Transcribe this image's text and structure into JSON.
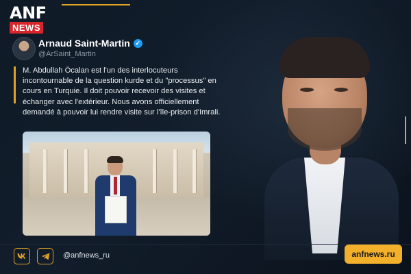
{
  "logo": {
    "line1": "ANF",
    "line2": "NEWS"
  },
  "tweet": {
    "author": "Arnaud Saint-Martin",
    "handle": "@ArSaint_Martin",
    "text": "M. Abdullah Öcalan est l'un des interlocuteurs incontournable de la question kurde et du \"processus\" en cours en Turquie. Il doit pouvoir recevoir des visites et échanger avec l'extérieur. Nous avons officiellement demandé à pouvoir lui rendre visite sur l'île-prison d'Imrali."
  },
  "footer": {
    "handle": "@anfnews_ru",
    "site_button": "anfnews.ru",
    "icons": [
      "vk-icon",
      "telegram-icon"
    ]
  },
  "colors": {
    "accent": "#e1a423",
    "news_red": "#d7262b",
    "background": "#0d1622"
  }
}
